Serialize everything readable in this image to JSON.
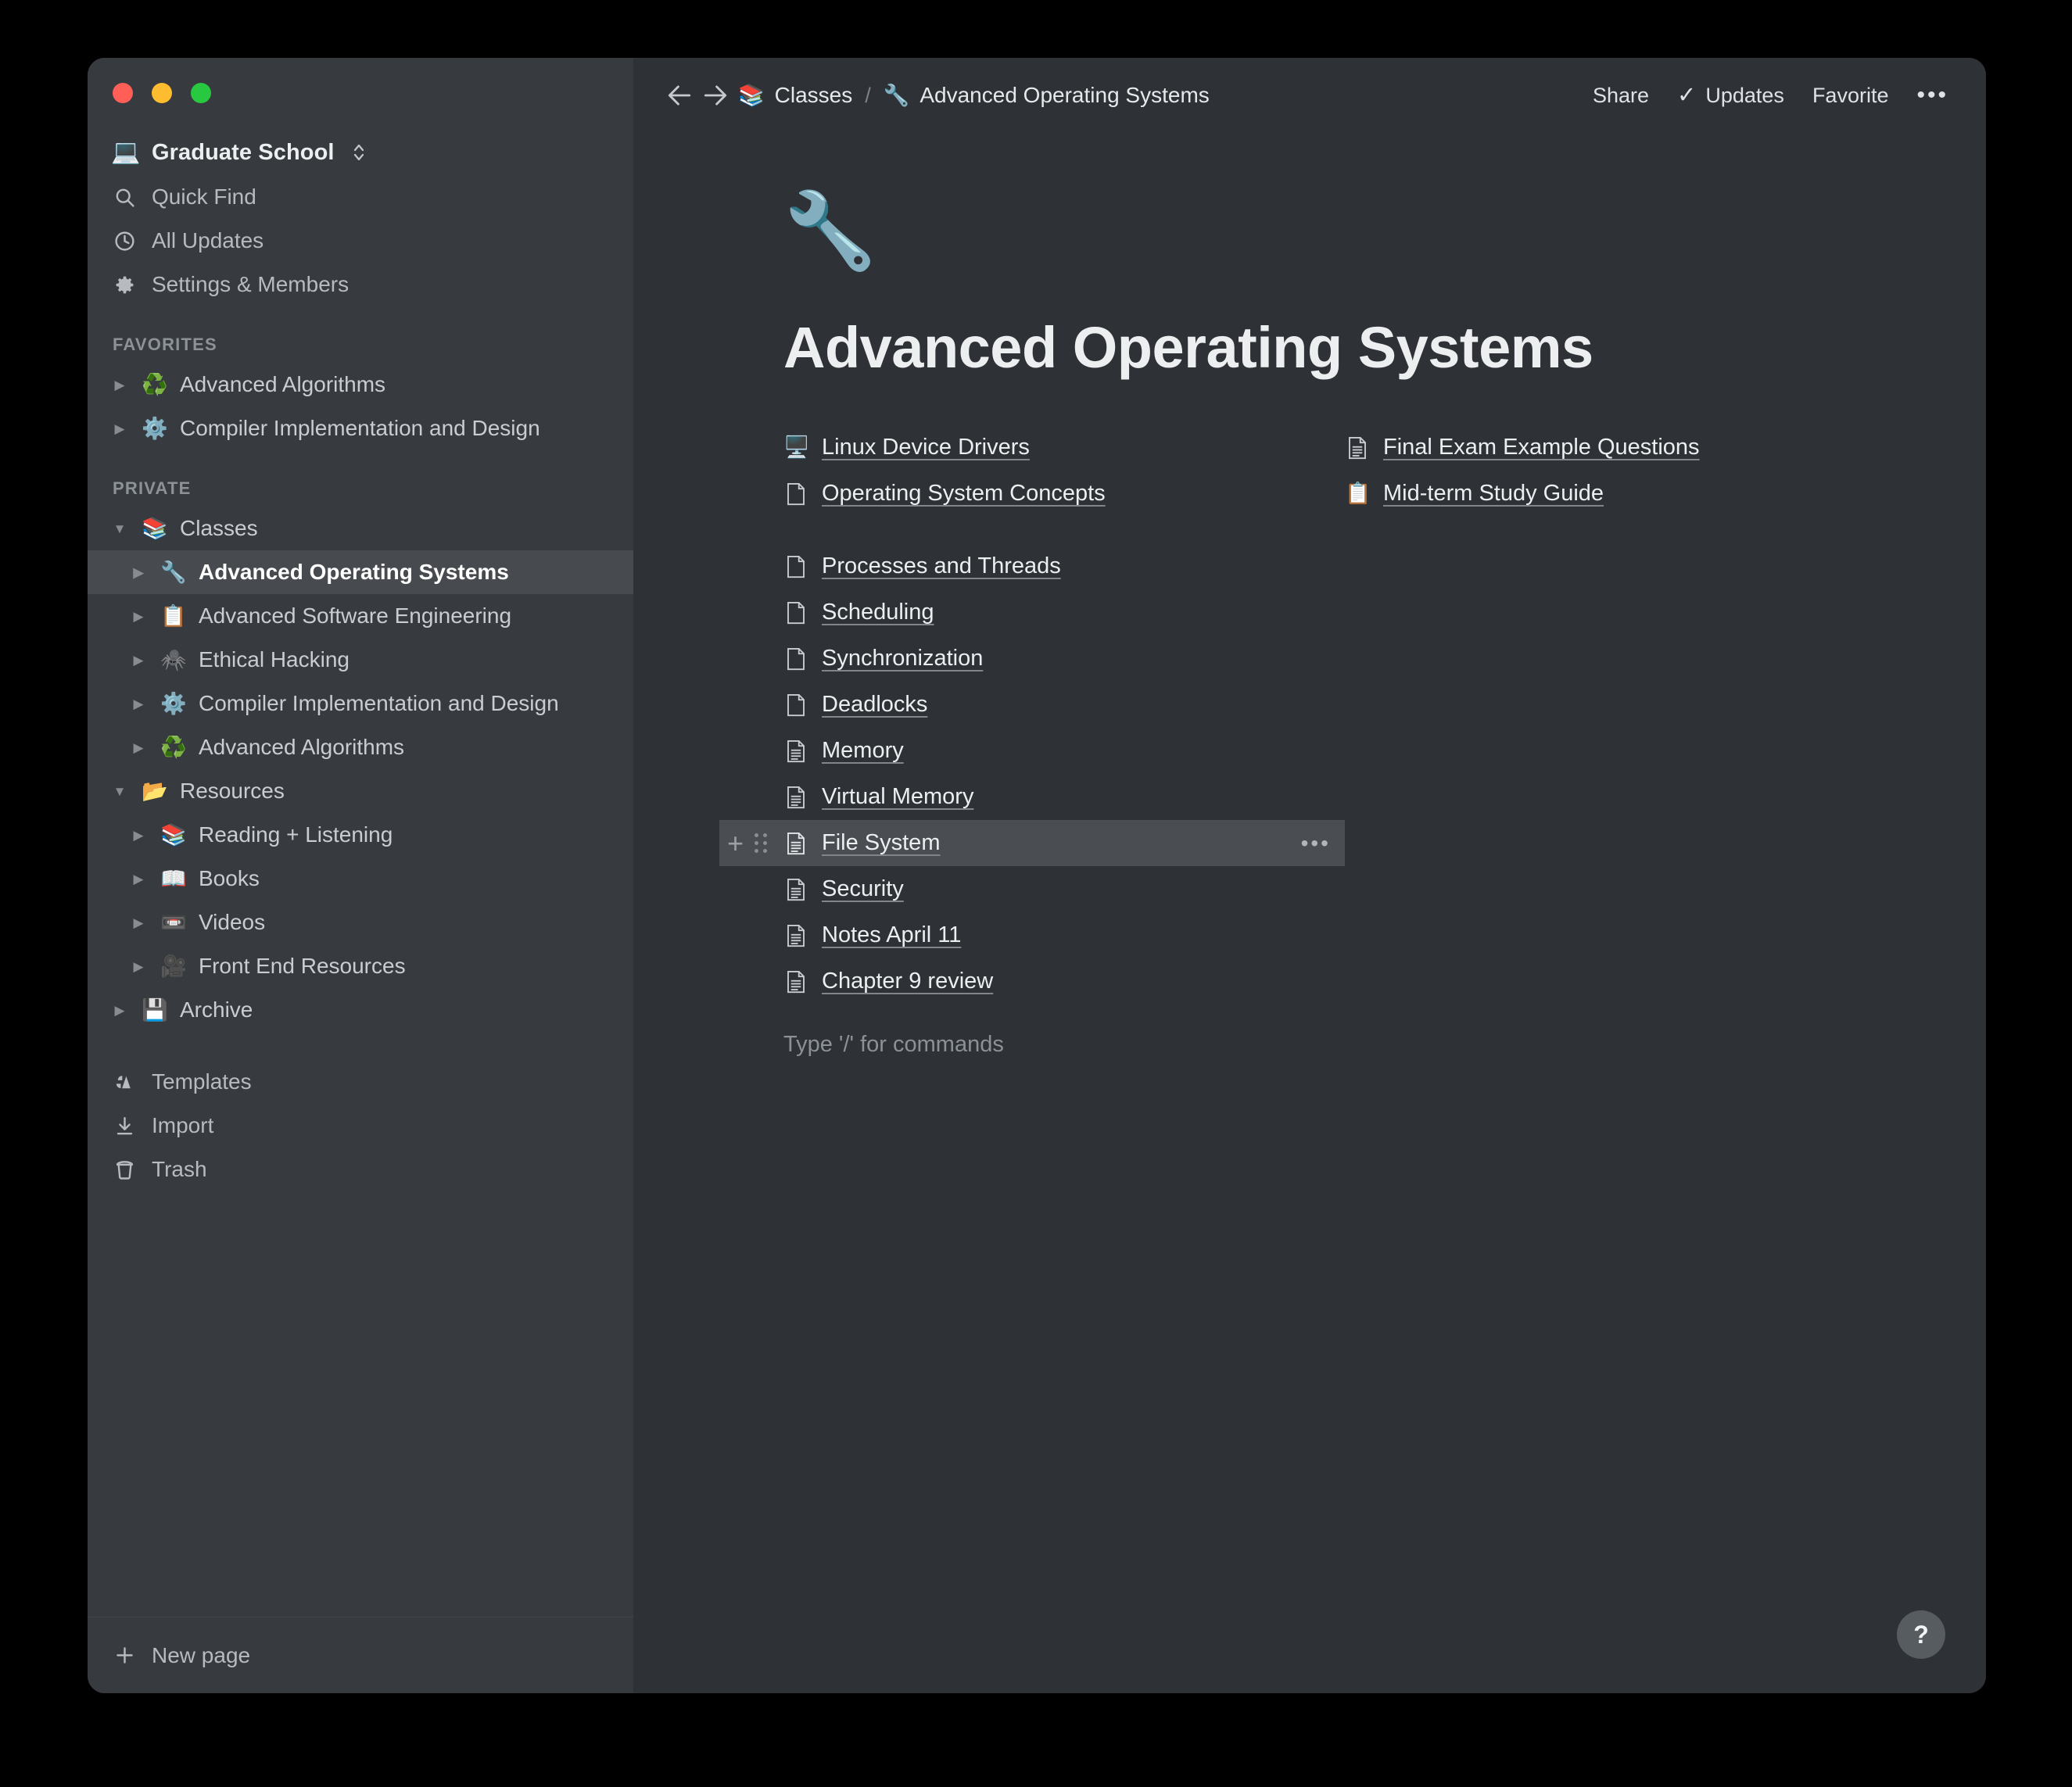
{
  "window": {
    "traffic_lights": [
      "close",
      "minimize",
      "maximize"
    ]
  },
  "sidebar": {
    "workspace": {
      "emoji": "💻",
      "name": "Graduate School",
      "switcher_icon": "chevron-updown-icon"
    },
    "nav": [
      {
        "icon": "search-icon",
        "label": "Quick Find"
      },
      {
        "icon": "clock-icon",
        "label": "All Updates"
      },
      {
        "icon": "gear-icon",
        "label": "Settings & Members"
      }
    ],
    "favorites_label": "FAVORITES",
    "favorites": [
      {
        "arrow": "▶",
        "emoji": "♻️",
        "label": "Advanced Algorithms"
      },
      {
        "arrow": "▶",
        "emoji": "⚙️",
        "label": "Compiler Implementation and Design"
      }
    ],
    "private_label": "PRIVATE",
    "private": [
      {
        "arrow": "▼",
        "emoji": "📚",
        "label": "Classes",
        "indent": 0,
        "selected": false
      },
      {
        "arrow": "▶",
        "emoji": "🔧",
        "label": "Advanced Operating Systems",
        "indent": 1,
        "selected": true
      },
      {
        "arrow": "▶",
        "emoji": "📋",
        "label": "Advanced Software Engineering",
        "indent": 1,
        "selected": false
      },
      {
        "arrow": "▶",
        "emoji": "🕷️",
        "label": "Ethical Hacking",
        "indent": 1,
        "selected": false
      },
      {
        "arrow": "▶",
        "emoji": "⚙️",
        "label": "Compiler Implementation and Design",
        "indent": 1,
        "selected": false
      },
      {
        "arrow": "▶",
        "emoji": "♻️",
        "label": "Advanced Algorithms",
        "indent": 1,
        "selected": false
      },
      {
        "arrow": "▼",
        "emoji": "📂",
        "label": "Resources",
        "indent": 0,
        "selected": false
      },
      {
        "arrow": "▶",
        "emoji": "📚",
        "label": "Reading + Listening",
        "indent": 1,
        "selected": false
      },
      {
        "arrow": "▶",
        "emoji": "📖",
        "label": "Books",
        "indent": 1,
        "selected": false
      },
      {
        "arrow": "▶",
        "emoji": "📼",
        "label": "Videos",
        "indent": 1,
        "selected": false
      },
      {
        "arrow": "▶",
        "emoji": "🎥",
        "label": "Front End Resources",
        "indent": 1,
        "selected": false
      },
      {
        "arrow": "▶",
        "emoji": "💾",
        "label": "Archive",
        "indent": 0,
        "selected": false
      }
    ],
    "utility": [
      {
        "icon": "templates-icon",
        "label": "Templates"
      },
      {
        "icon": "import-icon",
        "label": "Import"
      },
      {
        "icon": "trash-icon",
        "label": "Trash"
      }
    ],
    "footer": {
      "icon": "plus-icon",
      "label": "New page"
    }
  },
  "topbar": {
    "back_icon": "arrow-left-icon",
    "forward_icon": "arrow-right-icon",
    "breadcrumb": [
      {
        "emoji": "📚",
        "label": "Classes"
      },
      {
        "emoji": "🔧",
        "label": "Advanced Operating Systems"
      }
    ],
    "separator": "/",
    "share_label": "Share",
    "updates_label": "Updates",
    "updates_check": "✓",
    "favorite_label": "Favorite",
    "more_label": "•••"
  },
  "page": {
    "emoji": "🔧",
    "title": "Advanced Operating Systems",
    "placeholder": "Type '/' for commands",
    "left_column": [
      {
        "icon_type": "emoji",
        "emoji": "🖥️",
        "label": "Linux Device Drivers",
        "highlight": false
      },
      {
        "icon_type": "page-blank",
        "label": "Operating System Concepts",
        "highlight": false
      },
      {
        "icon_type": "gap",
        "label": "",
        "highlight": false
      },
      {
        "icon_type": "page-blank",
        "label": "Processes and Threads",
        "highlight": false
      },
      {
        "icon_type": "page-blank",
        "label": "Scheduling",
        "highlight": false
      },
      {
        "icon_type": "page-blank",
        "label": "Synchronization",
        "highlight": false
      },
      {
        "icon_type": "page-blank",
        "label": "Deadlocks",
        "highlight": false
      },
      {
        "icon_type": "page-lined",
        "label": "Memory",
        "highlight": false
      },
      {
        "icon_type": "page-lined",
        "label": "Virtual Memory",
        "highlight": false
      },
      {
        "icon_type": "page-lined",
        "label": "File System",
        "highlight": true
      },
      {
        "icon_type": "page-lined",
        "label": "Security",
        "highlight": false
      },
      {
        "icon_type": "page-lined",
        "label": "Notes April 11",
        "highlight": false
      },
      {
        "icon_type": "page-lined",
        "label": "Chapter 9 review",
        "highlight": false
      }
    ],
    "right_column": [
      {
        "icon_type": "page-lined",
        "label": "Final Exam Example Questions"
      },
      {
        "icon_type": "emoji",
        "emoji": "📋",
        "label": "Mid-term Study Guide"
      }
    ],
    "block_controls": {
      "add_icon": "plus-icon",
      "drag_icon": "drag-handle-icon",
      "more_icon": "ellipsis-icon",
      "more_label": "•••"
    }
  },
  "help": {
    "label": "?"
  },
  "colors": {
    "sidebar_bg": "#373b3f",
    "main_bg": "#2e3236",
    "highlight": "#4a4e52",
    "selected_row": "#474b4f",
    "text_primary": "#eceef0",
    "text_secondary": "#b7bbbf",
    "text_muted": "#8b9195"
  }
}
